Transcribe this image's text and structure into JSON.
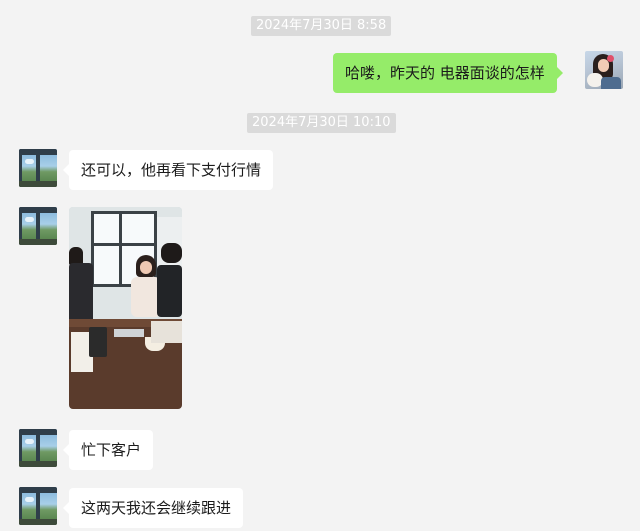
{
  "chat": {
    "timestamps": [
      "2024年7月30日 8:58",
      "2024年7月30日 10:10"
    ],
    "messages": [
      {
        "sender": "self",
        "type": "text",
        "text": "哈喽，昨天的 电器面谈的怎样"
      },
      {
        "sender": "other",
        "type": "text",
        "text": "还可以，他再看下支付行情"
      },
      {
        "sender": "other",
        "type": "image",
        "image_desc": "meeting-photo"
      },
      {
        "sender": "other",
        "type": "text",
        "text": "忙下客户"
      },
      {
        "sender": "other",
        "type": "text",
        "text": "这两天我还会继续跟进"
      }
    ]
  },
  "colors": {
    "background": "#f3f3f3",
    "self_bubble": "#95ec69",
    "other_bubble": "#ffffff",
    "timestamp_bg": "#dadada"
  },
  "icons": {
    "self_avatar": "girl-with-dog-avatar",
    "other_avatar": "window-view-avatar"
  }
}
